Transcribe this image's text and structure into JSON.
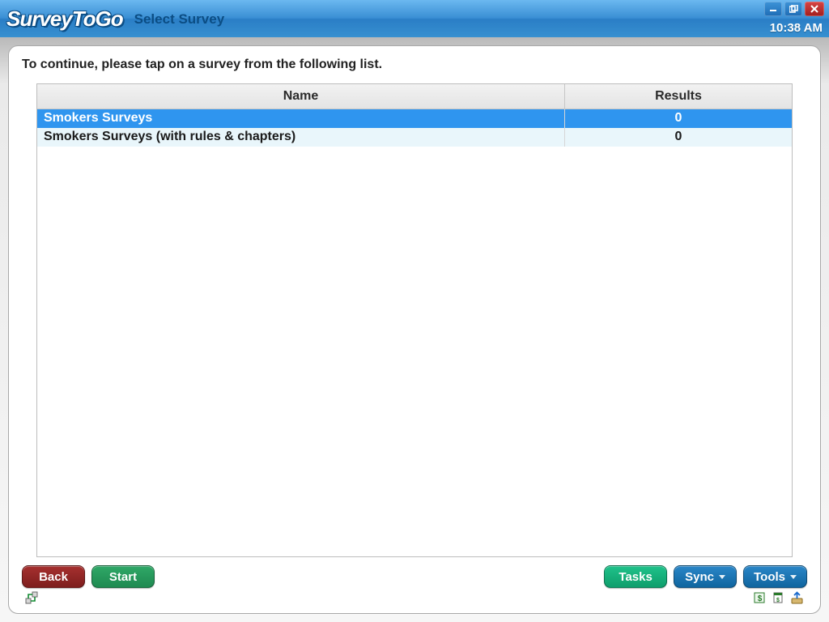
{
  "titlebar": {
    "logo": "SurveyToGo",
    "title": "Select Survey",
    "clock": "10:38 AM"
  },
  "instruction": "To continue, please tap on a survey from the following list.",
  "columns": {
    "name": "Name",
    "results": "Results"
  },
  "rows": [
    {
      "name": "Smokers Surveys",
      "results": "0",
      "selected": true
    },
    {
      "name": "Smokers Surveys (with rules & chapters)",
      "results": "0",
      "selected": false
    }
  ],
  "buttons": {
    "back": "Back",
    "start": "Start",
    "tasks": "Tasks",
    "sync": "Sync",
    "tools": "Tools"
  }
}
